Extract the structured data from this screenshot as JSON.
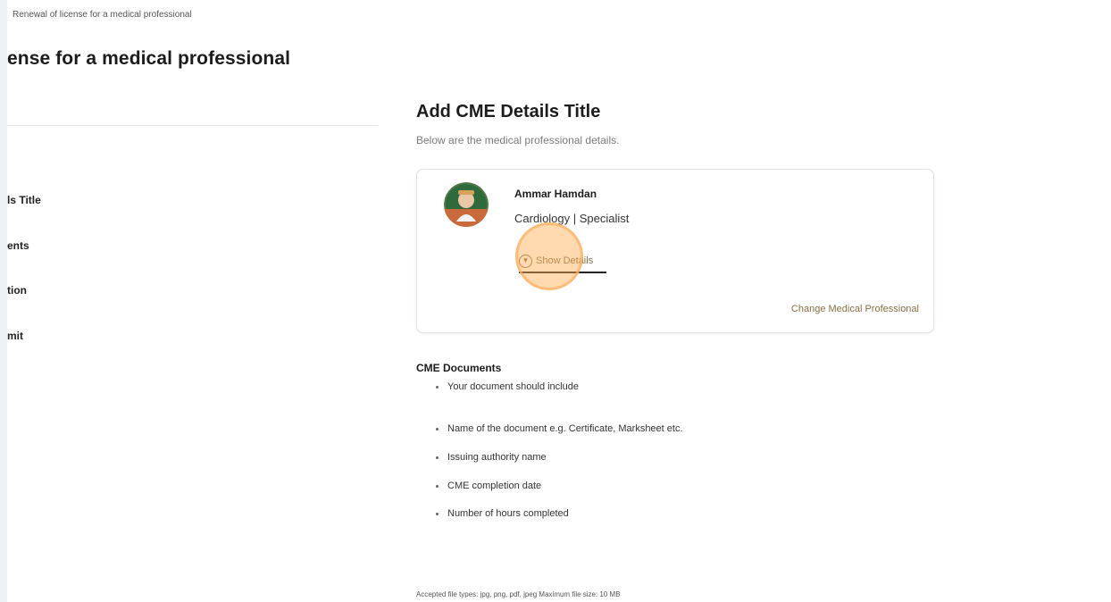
{
  "breadcrumb": "Renewal of license for a medical professional",
  "page_title": "ense for a medical professional",
  "steps": [
    "ls Title",
    "ents",
    "tion",
    "mit"
  ],
  "section": {
    "title": "Add CME Details Title",
    "subtitle": "Below are the medical professional details."
  },
  "professional": {
    "name": "Ammar Hamdan",
    "specialty": "Cardiology | Specialist",
    "show_details": "Show Details",
    "change_link": "Change Medical Professional"
  },
  "documents": {
    "title": "CME Documents",
    "items": [
      "Your document should include",
      "Name of the document e.g. Certificate, Marksheet etc.",
      "Issuing authority name",
      "CME completion date",
      "Number of hours completed"
    ]
  },
  "footnote": "Accepted file types: jpg, png, pdf, jpeg Maximum file size: 10 MB",
  "colors": {
    "accent": "#8a6f45",
    "click_highlight": "#ffaa50"
  },
  "icons": {
    "show_details": "chevron-down-circle-icon"
  }
}
